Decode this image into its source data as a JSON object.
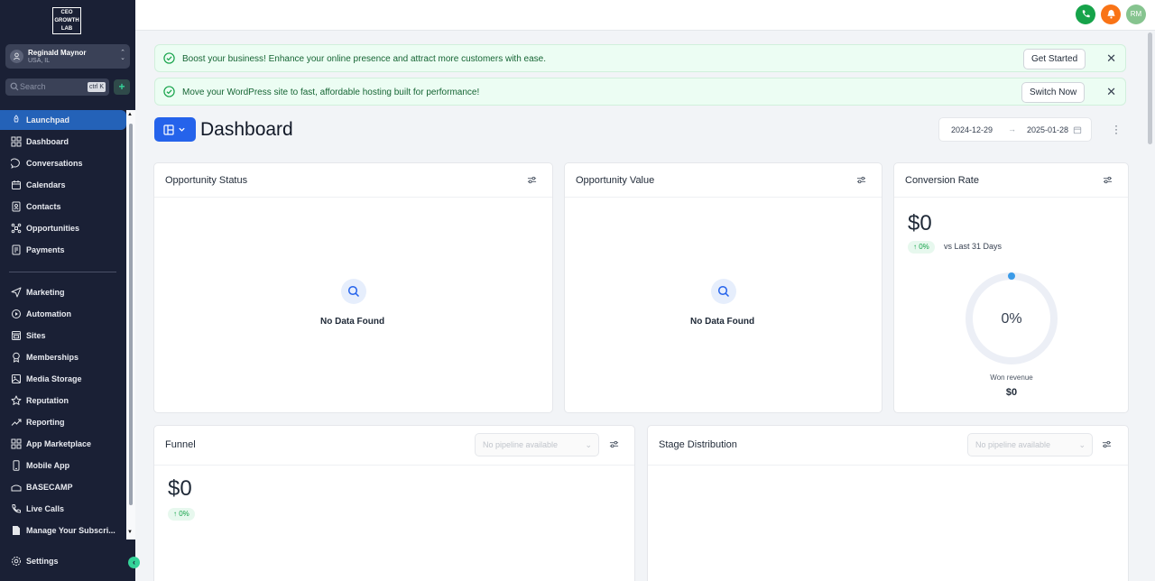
{
  "brand": {
    "logo_lines": [
      "CEO",
      "GROWTH",
      "LAB"
    ]
  },
  "account": {
    "name": "Reginald Maynor",
    "location": "USA, IL"
  },
  "search": {
    "placeholder": "Search",
    "shortcut": "ctrl K"
  },
  "nav": {
    "items": [
      {
        "label": "Launchpad",
        "icon": "rocket-icon",
        "active": true
      },
      {
        "label": "Dashboard",
        "icon": "grid-icon"
      },
      {
        "label": "Conversations",
        "icon": "chat-icon"
      },
      {
        "label": "Calendars",
        "icon": "calendar-icon"
      },
      {
        "label": "Contacts",
        "icon": "contacts-icon"
      },
      {
        "label": "Opportunities",
        "icon": "opportunities-icon"
      },
      {
        "label": "Payments",
        "icon": "payments-icon"
      }
    ],
    "items2": [
      {
        "label": "Marketing",
        "icon": "send-icon"
      },
      {
        "label": "Automation",
        "icon": "automation-icon"
      },
      {
        "label": "Sites",
        "icon": "sites-icon"
      },
      {
        "label": "Memberships",
        "icon": "award-icon"
      },
      {
        "label": "Media Storage",
        "icon": "image-icon"
      },
      {
        "label": "Reputation",
        "icon": "star-icon"
      },
      {
        "label": "Reporting",
        "icon": "trend-icon"
      },
      {
        "label": "App Marketplace",
        "icon": "apps-icon"
      },
      {
        "label": "Mobile App",
        "icon": "mobile-icon"
      },
      {
        "label": "BASECAMP",
        "icon": "basecamp-icon"
      },
      {
        "label": "Live Calls",
        "icon": "phone-icon"
      },
      {
        "label": "Manage Your Subscri...",
        "icon": "document-icon"
      }
    ],
    "settings": {
      "label": "Settings",
      "icon": "gear-icon"
    }
  },
  "topbar": {
    "user_initials": "RM",
    "colors": {
      "phone": "#16a34a",
      "bell": "#f97316",
      "avatar": "#86c48f"
    }
  },
  "banners": [
    {
      "text": "Boost your business! Enhance your online presence and attract more customers with ease.",
      "button": "Get Started"
    },
    {
      "text": "Move your WordPress site to fast, affordable hosting built for performance!",
      "button": "Switch Now"
    }
  ],
  "header": {
    "title": "Dashboard",
    "date_start": "2024-12-29",
    "date_end": "2025-01-28"
  },
  "cards": {
    "opportunity_status": {
      "title": "Opportunity Status",
      "empty": "No Data Found"
    },
    "opportunity_value": {
      "title": "Opportunity Value",
      "empty": "No Data Found"
    },
    "conversion_rate": {
      "title": "Conversion Rate",
      "value": "$0",
      "change": "↑ 0%",
      "compare": "vs Last 31 Days",
      "gauge_percent": "0%",
      "gauge_value": 0,
      "caption": "Won revenue",
      "caption_value": "$0"
    },
    "funnel": {
      "title": "Funnel",
      "select": "No pipeline available",
      "value": "$0",
      "change": "↑ 0%"
    },
    "stage_distribution": {
      "title": "Stage Distribution",
      "select": "No pipeline available"
    }
  },
  "colors": {
    "accent": "#2563eb",
    "sidebar": "#1a2035",
    "success": "#16a34a"
  }
}
